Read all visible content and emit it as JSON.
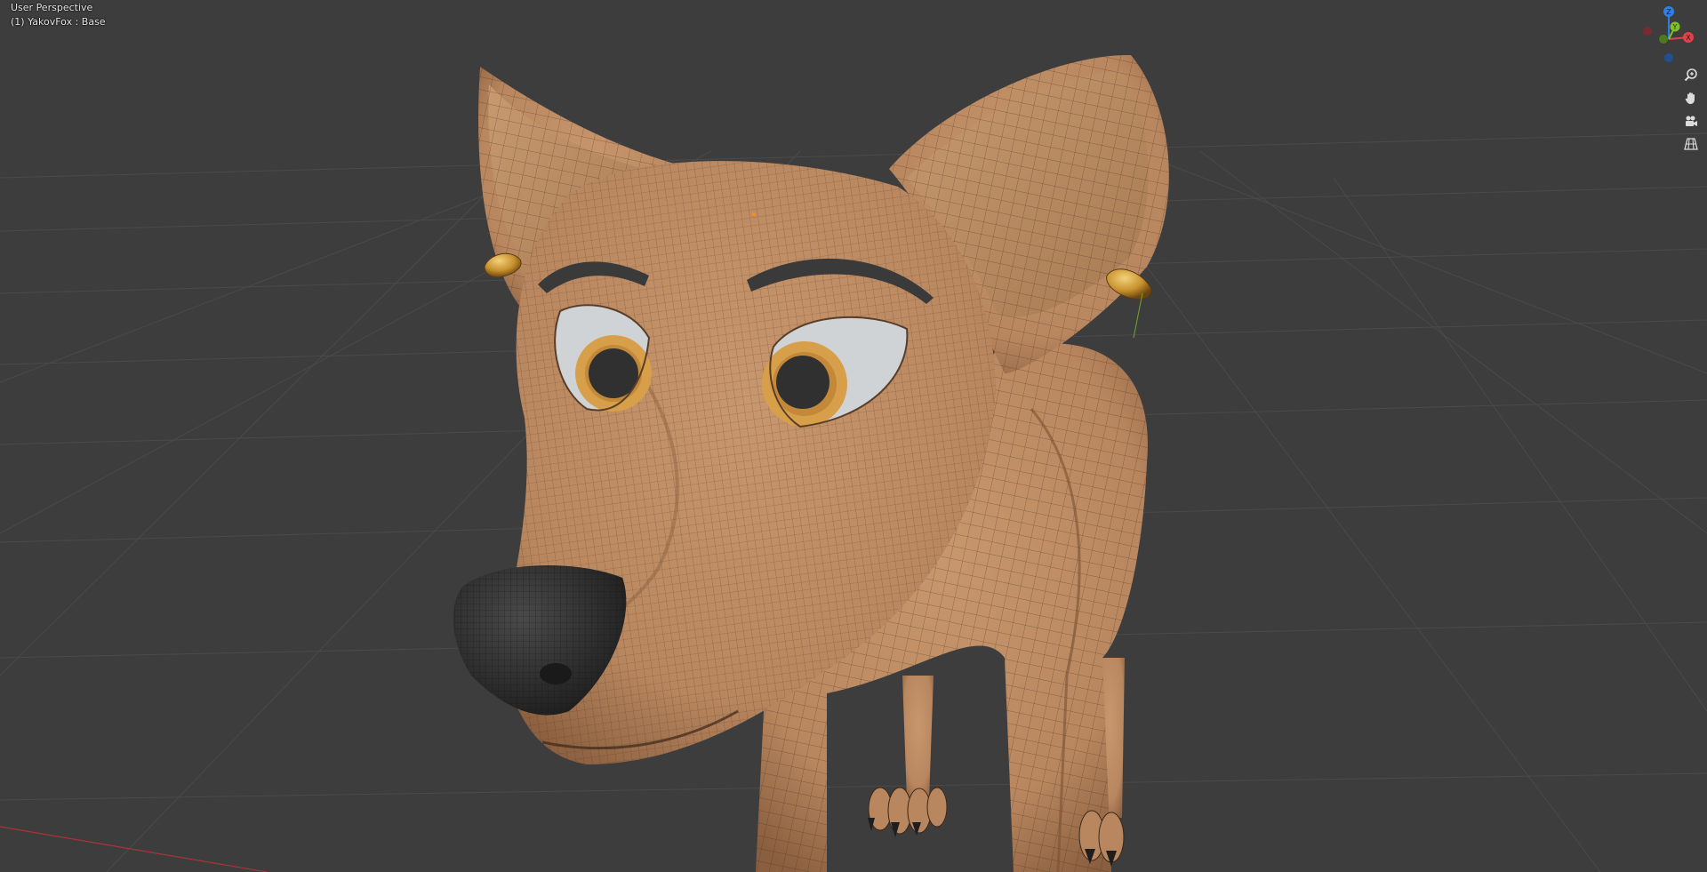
{
  "viewport": {
    "perspective_label": "User Perspective",
    "object_label": "(1) YakovFox : Base"
  },
  "gizmo": {
    "axes": [
      {
        "name": "Z",
        "color": "#2f7fe0"
      },
      {
        "name": "Y",
        "color": "#7fbf2a"
      },
      {
        "name": "X",
        "color": "#e0424a"
      }
    ]
  },
  "nav_tools": [
    {
      "icon": "zoom-icon"
    },
    {
      "icon": "hand-pan-icon"
    },
    {
      "icon": "camera-icon"
    },
    {
      "icon": "grid-toggle-icon"
    }
  ],
  "colors": {
    "background": "#3d3d3d",
    "grid_line": "#4a4a4a",
    "x_axis_line": "#a8353a",
    "fur": "#b9875f",
    "fur_shadow": "#8a5f3f",
    "wire": "#3a2718",
    "nose": "#2e2e2e",
    "eye_white": "#cfd3d6",
    "iris": "#d79f4a",
    "pupil": "#303030",
    "earring": "#c7902e",
    "brow": "#3a3a3a"
  }
}
